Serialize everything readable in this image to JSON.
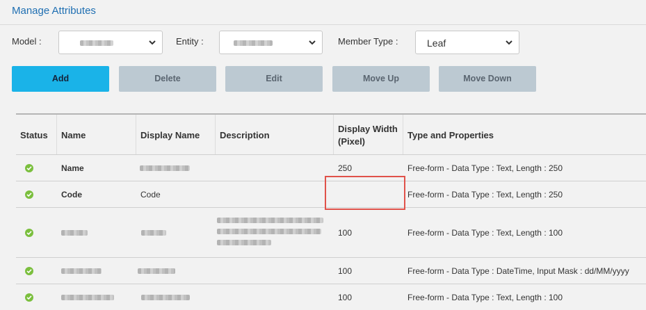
{
  "page": {
    "title": "Manage Attributes"
  },
  "filters": {
    "model_label": "Model :",
    "entity_label": "Entity :",
    "member_type_label": "Member Type :",
    "member_type_value": "Leaf"
  },
  "toolbar": {
    "add": "Add",
    "delete": "Delete",
    "edit": "Edit",
    "move_up": "Move Up",
    "move_down": "Move Down"
  },
  "table": {
    "headers": {
      "status": "Status",
      "name": "Name",
      "display_name": "Display Name",
      "description": "Description",
      "display_width_1": "Display Width",
      "display_width_2": "(Pixel)",
      "type": "Type and Properties"
    },
    "rows": [
      {
        "status": "ok",
        "name": "Name",
        "display_name": "",
        "width": "250",
        "type": "Free-form - Data Type : Text, Length : 250"
      },
      {
        "status": "ok",
        "name": "Code",
        "display_name": "Code",
        "width": "",
        "type": "Free-form - Data Type : Text, Length : 250"
      },
      {
        "status": "ok",
        "name": "",
        "display_name": "",
        "width": "100",
        "type": "Free-form - Data Type : Text, Length : 100"
      },
      {
        "status": "ok",
        "name": "",
        "display_name": "",
        "width": "100",
        "type": "Free-form - Data Type : DateTime, Input Mask : dd/MM/yyyy"
      },
      {
        "status": "ok",
        "name": "",
        "display_name": "",
        "width": "100",
        "type": "Free-form - Data Type : Text, Length : 100"
      }
    ]
  },
  "colors": {
    "accent": "#1ab3e8",
    "title": "#1f6fb2",
    "status_ok": "#7bbf3e",
    "highlight": "#e0524a"
  }
}
